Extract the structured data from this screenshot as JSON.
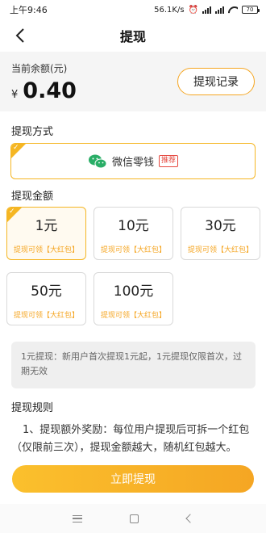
{
  "status_bar": {
    "time": "上午9:46",
    "speed": "56.1K/s",
    "battery": "70"
  },
  "nav": {
    "title": "提现"
  },
  "balance": {
    "label": "当前余额(元)",
    "currency": "¥",
    "value": "0.40",
    "record_button": "提现记录"
  },
  "withdraw_method": {
    "section_title": "提现方式",
    "method_name": "微信零钱",
    "badge": "推荐"
  },
  "withdraw_amount": {
    "section_title": "提现金额",
    "options": [
      {
        "value": "1元",
        "sub_prefix": "提现可领",
        "sub_highlight": "【大红包】",
        "selected": true
      },
      {
        "value": "10元",
        "sub_prefix": "提现可领",
        "sub_highlight": "【大红包】",
        "selected": false
      },
      {
        "value": "30元",
        "sub_prefix": "提现可领",
        "sub_highlight": "【大红包】",
        "selected": false
      },
      {
        "value": "50元",
        "sub_prefix": "提现可领",
        "sub_highlight": "【大红包】",
        "selected": false
      },
      {
        "value": "100元",
        "sub_prefix": "提现可领",
        "sub_highlight": "【大红包】",
        "selected": false
      }
    ]
  },
  "note": {
    "text": "1元提现：新用户首次提现1元起，1元提现仅限首次，过期无效"
  },
  "rules": {
    "section_title": "提现规则",
    "text": "1、提现额外奖励：每位用户提现后可拆一个红包（仅限前三次），提现金额越大，随机红包越大。"
  },
  "submit": {
    "label": "立即提现"
  },
  "colors": {
    "accent": "#f5a623",
    "badge_red": "#e5483f"
  }
}
